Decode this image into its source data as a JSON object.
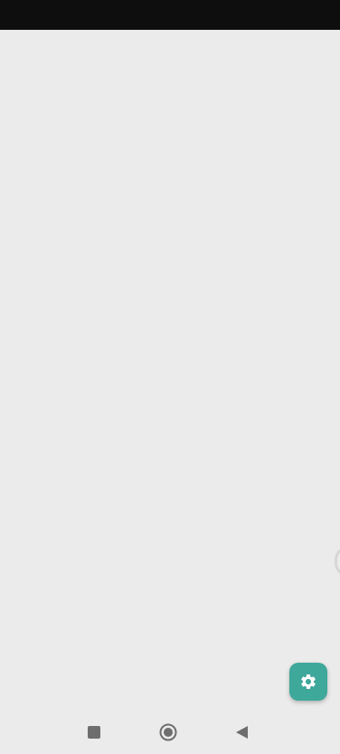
{
  "status_bar": {
    "color": "#0e0e0e"
  },
  "content": {
    "background": "#ebebeb"
  },
  "fab": {
    "icon": "gear-icon",
    "color": "#3ea89b"
  },
  "navigation": {
    "recents_icon": "square-icon",
    "home_icon": "circle-icon",
    "back_icon": "triangle-back-icon"
  }
}
